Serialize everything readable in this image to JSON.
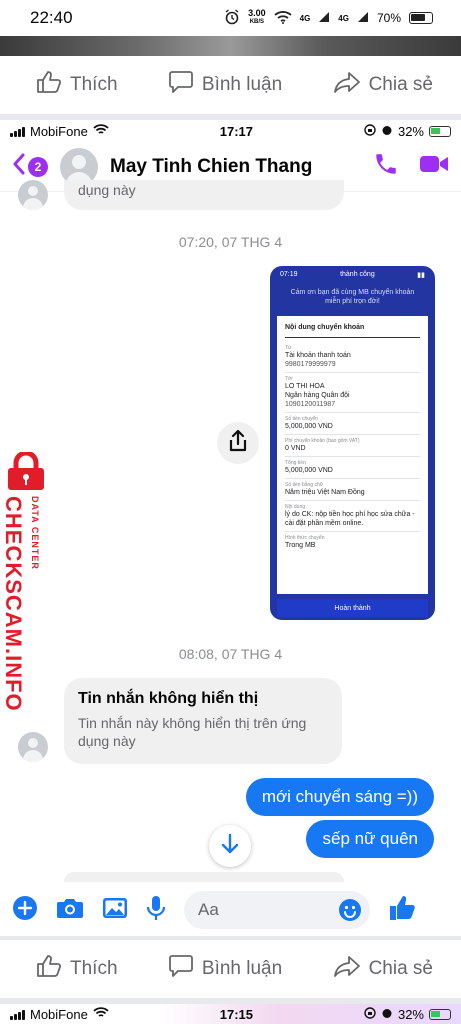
{
  "android_status": {
    "time": "22:40",
    "speed_value": "3.00",
    "speed_unit": "KB/S",
    "net1": "4G",
    "net2": "4G",
    "battery": "70%"
  },
  "facebook_actions": {
    "like": "Thích",
    "comment": "Bình luận",
    "share": "Chia sẻ"
  },
  "ios_status": {
    "carrier": "MobiFone",
    "time": "17:17",
    "battery": "32%"
  },
  "header": {
    "unread_count": "2",
    "contact_name": "May Tinh Chien Thang"
  },
  "chat": {
    "truncated_text": "dụng này",
    "timestamp_1": "07:20, 07 THG 4",
    "receipt": {
      "time": "07:19",
      "status": "thành công",
      "message": "Cảm ơn bạn đã cùng MB chuyển khoản miễn phí trọn đời!",
      "section_title": "Nội dung chuyển khoản",
      "from_label": "Từ",
      "from_name": "Tài khoản thanh toán",
      "from_number": "9980179999979",
      "to_label": "Tới",
      "to_name": "LO THI HOA",
      "to_bank": "Ngân hàng Quân đội",
      "to_number": "1090120011987",
      "amount_label": "Số tiền chuyển",
      "amount": "5,000,000 VND",
      "fee_label": "Phí chuyển khoản (bao gồm VAT)",
      "fee": "0 VND",
      "total_label": "Tổng tiền",
      "total": "5,000,000 VND",
      "words_label": "Số tiền bằng chữ",
      "words": "Năm triệu Việt Nam Đồng",
      "note_label": "Nội dung",
      "note": "lý do CK: nộp tiền học phí học sửa chữa -cài đặt phần mềm online.",
      "method_label": "Hình thức chuyển",
      "method": "Trong MB",
      "button": "Hoàn thành"
    },
    "timestamp_2": "08:08, 07 THG 4",
    "hidden_message": {
      "title": "Tin nhắn không hiển thị",
      "body": "Tin nhắn này không hiển thị trên ứng dụng này"
    },
    "outgoing": [
      "mới chuyển sáng =))",
      "sếp nữ quên"
    ]
  },
  "watermark": {
    "line1": "DATA CENTER",
    "line2": "CHECKSCAM.INFO"
  },
  "composer": {
    "placeholder": "Aa"
  },
  "ios_status_bottom": {
    "carrier": "MobiFone",
    "time": "17:15",
    "battery": "32%"
  },
  "colors": {
    "messenger_purple": "#9e2ff0",
    "fb_blue": "#1877f2",
    "watermark_red": "#e11d2b",
    "receipt_blue": "#2335a0"
  }
}
